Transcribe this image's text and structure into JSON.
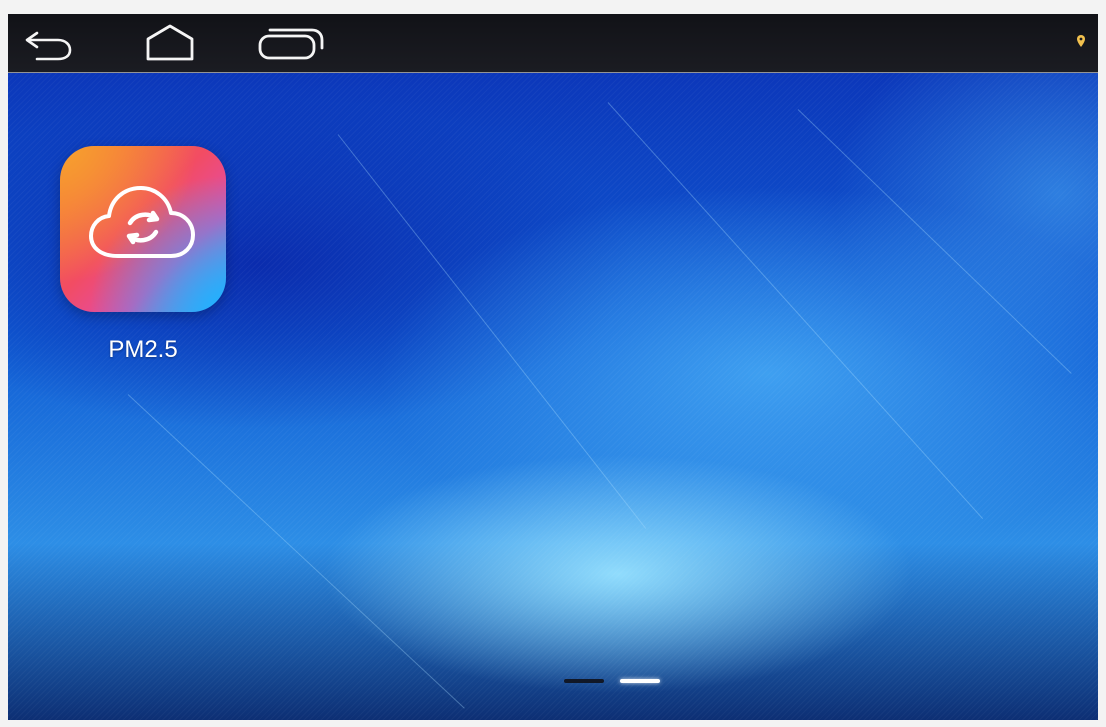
{
  "system_bar": {
    "nav_buttons": [
      {
        "name": "back",
        "icon": "back-arrow-icon"
      },
      {
        "name": "home",
        "icon": "home-icon"
      },
      {
        "name": "recents",
        "icon": "recent-apps-icon"
      }
    ],
    "status_icons": [
      {
        "name": "location",
        "icon": "location-pin-icon"
      }
    ]
  },
  "home_screen": {
    "apps": [
      {
        "label": "PM2.5",
        "icon": "cloud-sync-icon",
        "colors": [
          "#f7a02f",
          "#f24c63",
          "#e34ca8",
          "#1fb2ff"
        ]
      }
    ],
    "page_indicator": {
      "page_count": 2,
      "current_page": 2
    }
  },
  "colors": {
    "status_bar": "#17181d",
    "wallpaper_primary": "#0f5bd4",
    "wallpaper_highlight": "#96e1ff",
    "active_page": "#ffffff",
    "inactive_page": "#111827"
  }
}
